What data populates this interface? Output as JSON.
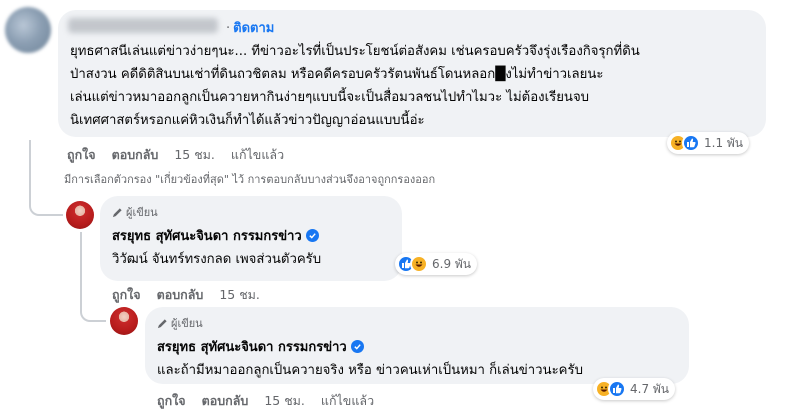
{
  "comment": {
    "follow_dot": "·",
    "follow_label": "ติดตาม",
    "lines": [
      "ยุทธศาสนีเล่นแต่ข่าวง่ายๆนะ... ทีข่าวอะไรที่เป็นประโยชน์ต่อสังคม เช่นครอบครัวจึงรุ่งเรืองกิจรุกที่ดิน",
      "ป่าสงวน คดีดิติสินบนเช่าที่ดินถวชิตลม หรือคดีครอบครัวรัตนพันธ์โดนหลอก█งไม่ทำข่าวเลยนะ",
      "เล่นแต่ข่าวหมาออกลูกเป็นควายหากินง่ายๆแบบนี้จะเป็นสื่อมวลชนไปทำไมวะ ไม่ต้องเรียนจบ",
      "นิเทศศาสตร์หรอกแค่หิวเงินก็ทำได้แล้วข่าวปัญญาอ่อนแบบนี้อ่ะ"
    ],
    "reaction_count": "1.1 พัน",
    "actions": {
      "like": "ถูกใจ",
      "reply": "ตอบกลับ",
      "time": "15 ชม.",
      "edited": "แก้ไขแล้ว"
    }
  },
  "filter_note": "มีการเลือกตัวกรอง \"เกี่ยวข้องที่สุด\" ไว้ การตอบกลับบางส่วนจึงอาจถูกกรองออก",
  "replies": [
    {
      "author_badge": "ผู้เขียน",
      "author": "สรยุทธ สุทัศนะจินดา กรรมกรข่าว",
      "text": "วิวัฒน์ จันทร์ทรงกลด เพจส่วนตัวครับ",
      "reaction_count": "6.9 พัน",
      "actions": {
        "like": "ถูกใจ",
        "reply": "ตอบกลับ",
        "time": "15 ชม."
      }
    },
    {
      "author_badge": "ผู้เขียน",
      "author": "สรยุทธ สุทัศนะจินดา กรรมกรข่าว",
      "text": "และถ้ามีหมาออกลูกเป็นควายจริง หรือ ข่าวคนเห่าเป็นหมา ก็เล่นข่าวนะครับ",
      "reaction_count": "4.7 พัน",
      "actions": {
        "like": "ถูกใจ",
        "reply": "ตอบกลับ",
        "time": "15 ชม.",
        "edited": "แก้ไขแล้ว"
      }
    }
  ],
  "colors": {
    "link": "#1877f2",
    "muted": "#65676b",
    "bubble": "#f0f2f5",
    "haha": "#f7b125",
    "like": "#1877f2"
  }
}
